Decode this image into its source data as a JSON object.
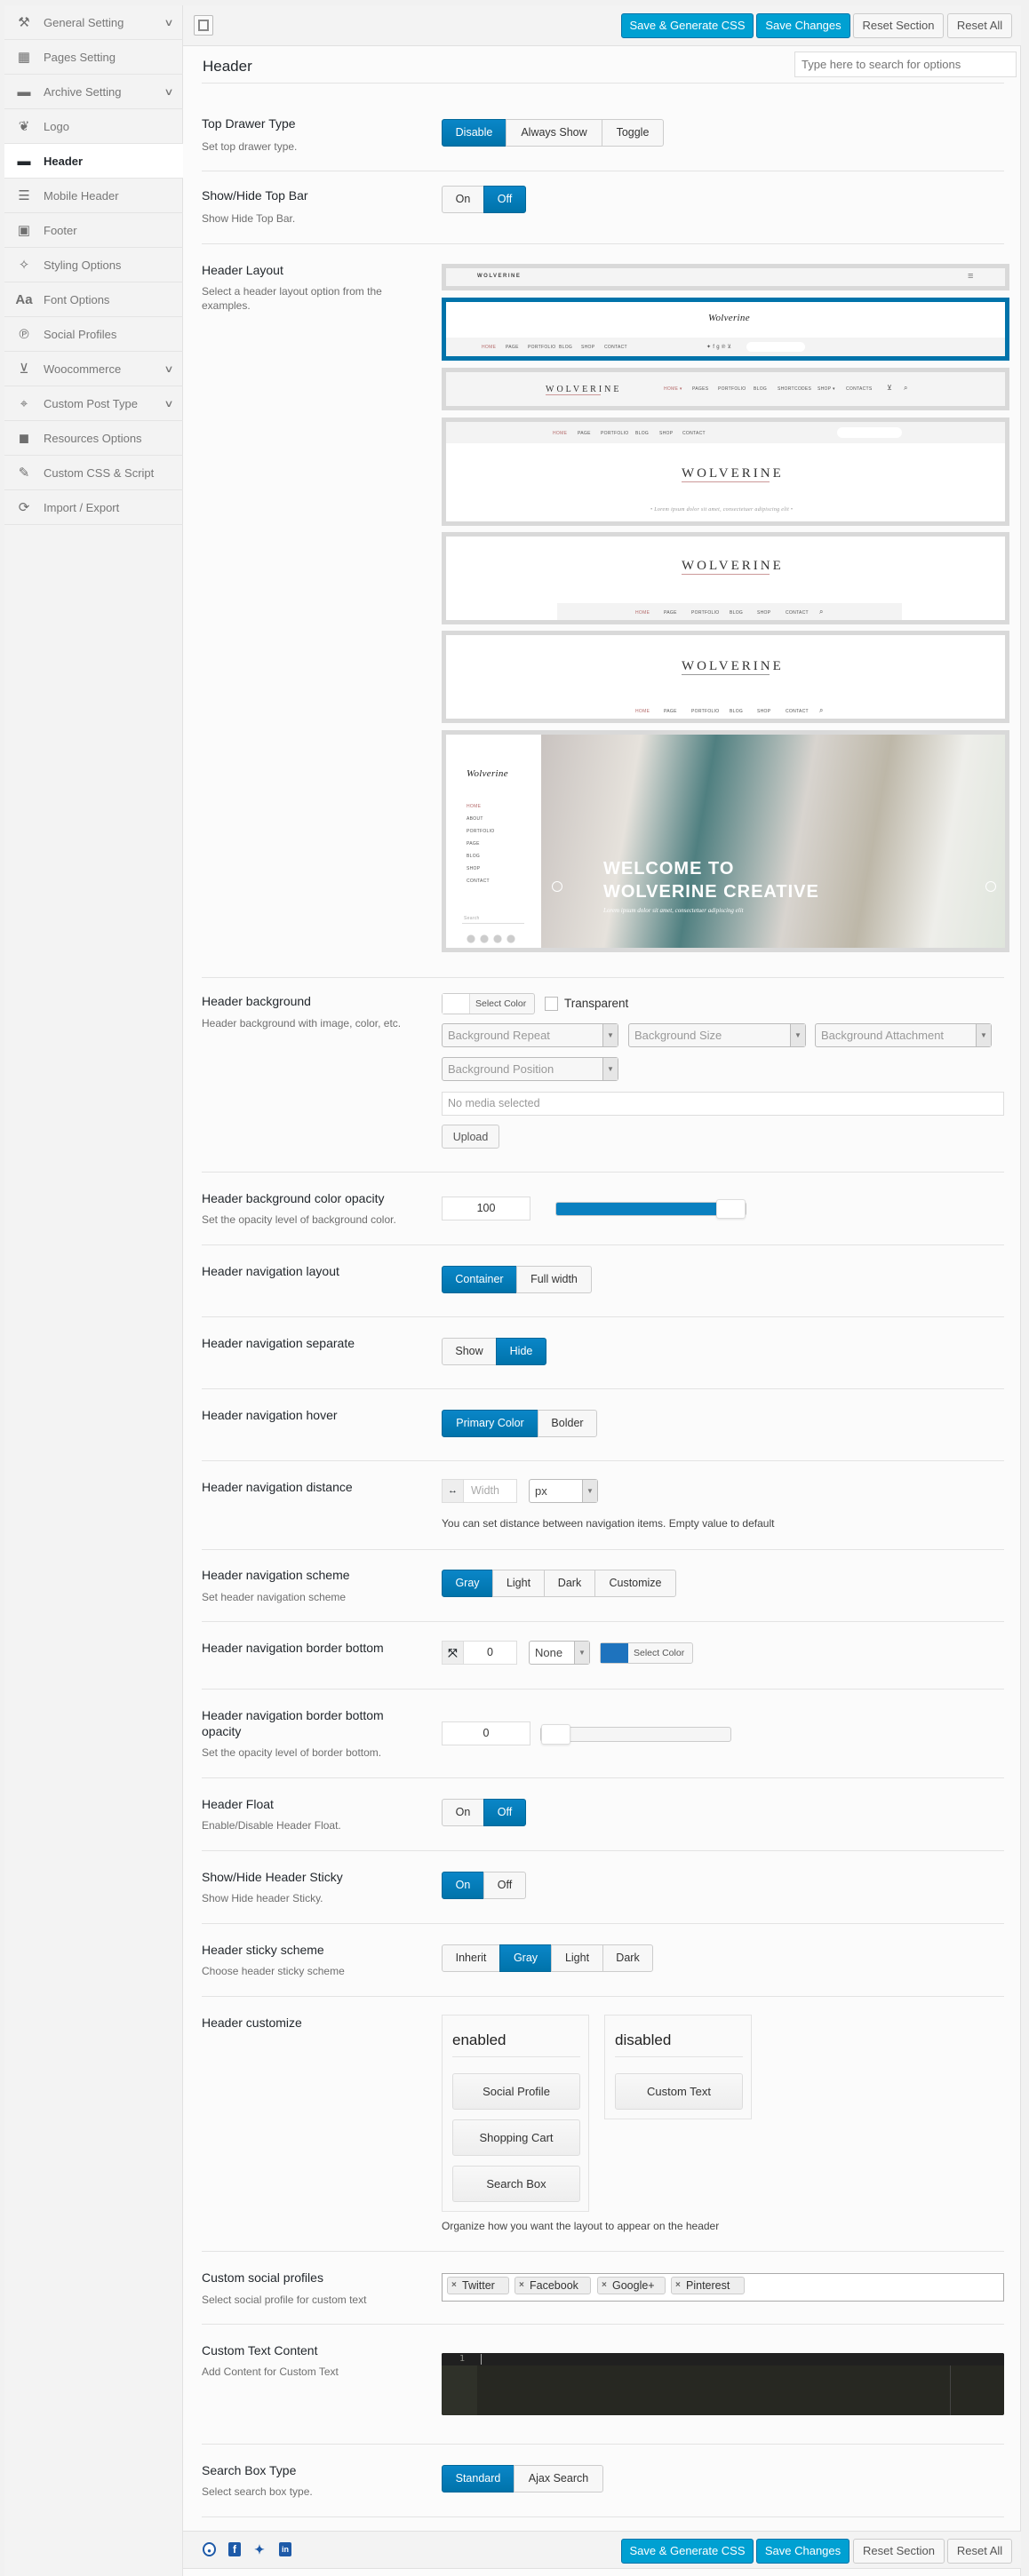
{
  "sidebar": {
    "items": [
      {
        "label": "General Setting",
        "icon": "wrench-icon",
        "has_children": true
      },
      {
        "label": "Pages Setting",
        "icon": "grid-icon",
        "has_children": false
      },
      {
        "label": "Archive Setting",
        "icon": "folder-icon",
        "has_children": true
      },
      {
        "label": "Logo",
        "icon": "leaf-icon",
        "has_children": false
      },
      {
        "label": "Header",
        "icon": "header-icon",
        "has_children": false,
        "active": true
      },
      {
        "label": "Mobile Header",
        "icon": "list-icon",
        "has_children": false
      },
      {
        "label": "Footer",
        "icon": "footer-icon",
        "has_children": false
      },
      {
        "label": "Styling Options",
        "icon": "magic-wand-icon",
        "has_children": false
      },
      {
        "label": "Font Options",
        "icon": "font-icon",
        "has_children": false
      },
      {
        "label": "Social Profiles",
        "icon": "pinterest-icon",
        "has_children": false
      },
      {
        "label": "Woocommerce",
        "icon": "cart-icon",
        "has_children": true
      },
      {
        "label": "Custom Post Type",
        "icon": "crosshair-icon",
        "has_children": true
      },
      {
        "label": "Resources Options",
        "icon": "grid-large-icon",
        "has_children": false
      },
      {
        "label": "Custom CSS & Script",
        "icon": "edit-icon",
        "has_children": false
      },
      {
        "label": "Import / Export",
        "icon": "refresh-icon",
        "has_children": false
      }
    ]
  },
  "toolbar": {
    "save_generate": "Save & Generate CSS",
    "save_changes": "Save Changes",
    "reset_section": "Reset Section",
    "reset_all": "Reset All",
    "primary_color": "#00a0d2"
  },
  "section": {
    "title": "Header",
    "search_placeholder": "Type here to search for options"
  },
  "fields": {
    "top_drawer": {
      "label": "Top Drawer Type",
      "desc": "Set top drawer type.",
      "options": [
        "Disable",
        "Always Show",
        "Toggle"
      ],
      "selected": "Disable"
    },
    "top_bar": {
      "label": "Show/Hide Top Bar",
      "desc": "Show Hide Top Bar.",
      "options": [
        "On",
        "Off"
      ],
      "selected": "Off"
    },
    "header_layout": {
      "label": "Header Layout",
      "desc": "Select a header layout option from the examples.",
      "selected_index": 1,
      "logo_text": "WOLVERINE",
      "script_logo": "Wolverine",
      "nav_a": [
        "HOME",
        "PAGE",
        "PORTFOLIO",
        "BLOG",
        "SHOP",
        "CONTACT"
      ],
      "nav_b": [
        "HOME ▾",
        "PAGES",
        "PORTFOLIO",
        "BLOG",
        "SHORTCODES",
        "SHOP ▾",
        "CONTACTS"
      ],
      "nav_side": [
        "HOME",
        "ABOUT",
        "PORTFOLIO",
        "PAGE",
        "BLOG",
        "SHOP",
        "CONTACT"
      ],
      "tagline": "• Lorem ipsum dolor sit amet, consectetuer adipiscing elit •",
      "hero_line1": "WELCOME TO",
      "hero_line2": "WOLVERINE CREATIVE",
      "hero_sub": "Lorem ipsum dolor sit amet, consectetuer adipiscing elit",
      "search_label": "Search"
    },
    "header_background": {
      "label": "Header background",
      "desc": "Header background with image, color, etc.",
      "select_color": "Select Color",
      "transparent_label": "Transparent",
      "transparent_checked": false,
      "repeat_placeholder": "Background Repeat",
      "size_placeholder": "Background Size",
      "attachment_placeholder": "Background Attachment",
      "position_placeholder": "Background Position",
      "media_placeholder": "No media selected",
      "upload": "Upload"
    },
    "bg_opacity": {
      "label": "Header background color opacity",
      "desc": "Set the opacity level of background color.",
      "value": "100",
      "slider_percent": 100
    },
    "nav_layout": {
      "label": "Header navigation layout",
      "options": [
        "Container",
        "Full width"
      ],
      "selected": "Container"
    },
    "nav_separate": {
      "label": "Header navigation separate",
      "options": [
        "Show",
        "Hide"
      ],
      "selected": "Hide"
    },
    "nav_hover": {
      "label": "Header navigation hover",
      "options": [
        "Primary Color",
        "Bolder"
      ],
      "selected": "Primary Color"
    },
    "nav_distance": {
      "label": "Header navigation distance",
      "width_placeholder": "Width",
      "unit": "px",
      "help": "You can set distance between navigation items. Empty value to default"
    },
    "nav_scheme": {
      "label": "Header navigation scheme",
      "desc": "Set header navigation scheme",
      "options": [
        "Gray",
        "Light",
        "Dark",
        "Customize"
      ],
      "selected": "Gray"
    },
    "nav_border": {
      "label": "Header navigation border bottom",
      "value": "0",
      "style": "None",
      "select_color": "Select Color",
      "color": "#1e73be"
    },
    "nav_border_opacity": {
      "label": "Header navigation border bottom opacity",
      "desc": "Set the opacity level of border bottom.",
      "value": "0",
      "slider_percent": 0
    },
    "header_float": {
      "label": "Header Float",
      "desc": "Enable/Disable Header Float.",
      "options": [
        "On",
        "Off"
      ],
      "selected": "Off"
    },
    "header_sticky": {
      "label": "Show/Hide Header Sticky",
      "desc": "Show Hide header Sticky.",
      "options": [
        "On",
        "Off"
      ],
      "selected": "On"
    },
    "sticky_scheme": {
      "label": "Header sticky scheme",
      "desc": "Choose header sticky scheme",
      "options": [
        "Inherit",
        "Gray",
        "Light",
        "Dark"
      ],
      "selected": "Gray"
    },
    "customize": {
      "label": "Header customize",
      "enabled_title": "enabled",
      "enabled": [
        "Social Profile",
        "Shopping Cart",
        "Search Box"
      ],
      "disabled_title": "disabled",
      "disabled": [
        "Custom Text"
      ],
      "help": "Organize how you want the layout to appear on the header"
    },
    "social_profiles": {
      "label": "Custom social profiles",
      "desc": "Select social profile for custom text",
      "tags": [
        "Twitter",
        "Facebook",
        "Google+",
        "Pinterest"
      ]
    },
    "custom_text": {
      "label": "Custom Text Content",
      "desc": "Add Content for Custom Text",
      "line_number": "1"
    },
    "search_type": {
      "label": "Search Box Type",
      "desc": "Select search box type.",
      "options": [
        "Standard",
        "Ajax Search"
      ],
      "selected": "Standard"
    }
  },
  "footer": {
    "icons": [
      "github-icon",
      "facebook-icon",
      "twitter-icon",
      "linkedin-icon"
    ],
    "save_generate": "Save & Generate CSS",
    "save_changes": "Save Changes",
    "reset_section": "Reset Section",
    "reset_all": "Reset All"
  }
}
